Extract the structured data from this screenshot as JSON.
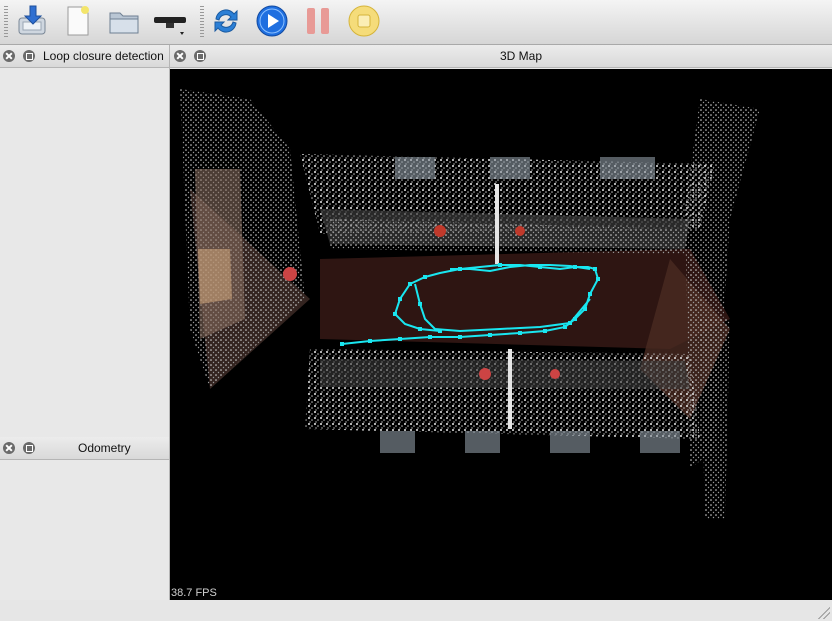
{
  "toolbar": {
    "items": [
      {
        "name": "download-database-icon"
      },
      {
        "name": "new-document-icon"
      },
      {
        "name": "open-folder-icon"
      },
      {
        "name": "camera-dropdown-icon"
      },
      {
        "name": "refresh-icon"
      },
      {
        "name": "play-icon"
      },
      {
        "name": "pause-icon"
      },
      {
        "name": "stop-icon"
      }
    ]
  },
  "docks": {
    "loop_closure": {
      "title": "Loop closure detection"
    },
    "odometry": {
      "title": "Odometry"
    },
    "map": {
      "title": "3D Map",
      "fps": "38.7 FPS"
    }
  },
  "colors": {
    "trajectory": "#19e6f0",
    "play": "#1f6fe0",
    "pause": "#e0504a",
    "stop": "#f2c22e",
    "refresh": "#2b7fd6"
  }
}
